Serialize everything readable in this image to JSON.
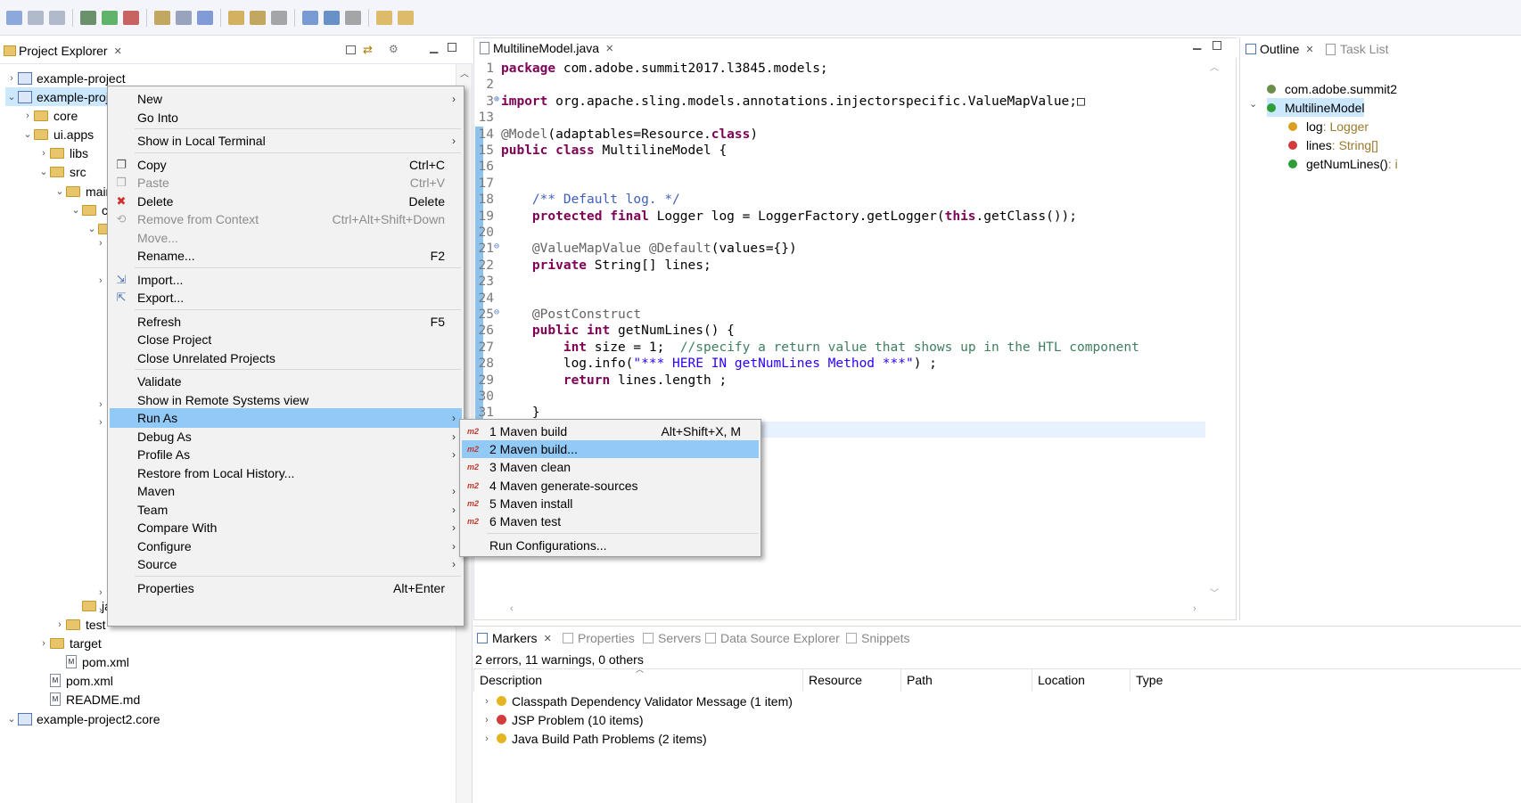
{
  "toolbar": {
    "icons": [
      "new-icon",
      "save-icon",
      "save-all-icon",
      "debug-icon",
      "run-icon",
      "run-external-icon",
      "new-package-icon",
      "new-class-icon",
      "open-type-icon",
      "open-folder-icon",
      "search-icon",
      "toggle-mark-icon",
      "globe-icon",
      "terminal-icon",
      "step-icon",
      "nav-back-icon",
      "nav-forward-icon"
    ]
  },
  "project_explorer": {
    "title": "Project Explorer",
    "tree": [
      {
        "label": "example-project",
        "depth": 0,
        "kind": "project",
        "chev": "›"
      },
      {
        "label": "example-proj",
        "depth": 0,
        "kind": "project",
        "chev": "⌄",
        "selected": true
      },
      {
        "label": "core",
        "depth": 1,
        "kind": "folder",
        "chev": "›"
      },
      {
        "label": "ui.apps",
        "depth": 1,
        "kind": "folder",
        "chev": "⌄"
      },
      {
        "label": "libs",
        "depth": 2,
        "kind": "folder",
        "chev": "›"
      },
      {
        "label": "src",
        "depth": 2,
        "kind": "folder",
        "chev": "⌄"
      },
      {
        "label": "mair",
        "depth": 3,
        "kind": "folder",
        "chev": "⌄"
      },
      {
        "label": "co",
        "depth": 4,
        "kind": "folder",
        "chev": "⌄"
      },
      {
        "label": "",
        "depth": 5,
        "kind": "folder",
        "chev": "⌄"
      },
      {
        "label": "ja",
        "depth": 4,
        "kind": "folder",
        "chev": ""
      },
      {
        "label": "test",
        "depth": 3,
        "kind": "folder",
        "chev": "›"
      },
      {
        "label": "target",
        "depth": 2,
        "kind": "folder",
        "chev": "›"
      },
      {
        "label": "pom.xml",
        "depth": 3,
        "kind": "file",
        "chev": ""
      },
      {
        "label": "pom.xml",
        "depth": 2,
        "kind": "file",
        "chev": ""
      },
      {
        "label": "README.md",
        "depth": 2,
        "kind": "file",
        "chev": ""
      },
      {
        "label": "example-project2.core",
        "depth": 0,
        "kind": "project",
        "chev": "⌄"
      }
    ]
  },
  "editor": {
    "tab": "MultilineModel.java",
    "lines": [
      {
        "n": "1",
        "html": "<span class='kw'>package</span> com.adobe.summit2017.l3845.models;"
      },
      {
        "n": "2",
        "html": ""
      },
      {
        "n": "3",
        "html": "<span class='kw'>import</span> org.apache.sling.models.annotations.injectorspecific.ValueMapValue;&#x25A1;"
      },
      {
        "n": "13",
        "html": ""
      },
      {
        "n": "14",
        "html": "<span class='ann'>@Model</span>(adaptables=Resource.<span class='kw'>class</span>)"
      },
      {
        "n": "15",
        "html": "<span class='kw'>public class</span> MultilineModel {"
      },
      {
        "n": "16",
        "html": ""
      },
      {
        "n": "17",
        "html": ""
      },
      {
        "n": "18",
        "html": "    <span class='cm'>/** Default log. */</span>"
      },
      {
        "n": "19",
        "html": "    <span class='kw'>protected final</span> Logger log = LoggerFactory.getLogger(<span class='kw'>this</span>.getClass());"
      },
      {
        "n": "20",
        "html": ""
      },
      {
        "n": "21",
        "html": "    <span class='ann'>@ValueMapValue @Default</span>(values={})"
      },
      {
        "n": "22",
        "html": "    <span class='kw'>private</span> String[] lines;"
      },
      {
        "n": "23",
        "html": ""
      },
      {
        "n": "24",
        "html": ""
      },
      {
        "n": "25",
        "html": "    <span class='ann'>@PostConstruct</span>"
      },
      {
        "n": "26",
        "html": "    <span class='kw'>public int</span> getNumLines() {"
      },
      {
        "n": "27",
        "html": "        <span class='kw'>int</span> size = 1;  <span class='cm2'>//specify a return value that shows up in the HTL component</span>"
      },
      {
        "n": "28",
        "html": "        log.info(<span class='str'>\"*** HERE IN getNumLines Method ***\"</span>) ;"
      },
      {
        "n": "29",
        "html": "        <span class='kw'>return</span> lines.length ;"
      },
      {
        "n": "30",
        "html": ""
      },
      {
        "n": "31",
        "html": "    }"
      }
    ]
  },
  "outline": {
    "tab": "Outline",
    "other_tab": "Task List",
    "items": [
      {
        "label": "com.adobe.summit2",
        "icon": "package-icon",
        "depth": 0,
        "type": ""
      },
      {
        "label": "MultilineModel",
        "icon": "class-icon",
        "depth": 0,
        "selected": true,
        "type": ""
      },
      {
        "label": "log",
        "icon": "field-icon",
        "depth": 1,
        "type": " : Logger"
      },
      {
        "label": "lines",
        "icon": "field-private-icon",
        "depth": 1,
        "type": " : String[]"
      },
      {
        "label": "getNumLines()",
        "icon": "method-icon",
        "depth": 1,
        "type": " : i"
      }
    ]
  },
  "markers": {
    "tabs": [
      "Markers",
      "Properties",
      "Servers",
      "Data Source Explorer",
      "Snippets"
    ],
    "summary": "2 errors, 11 warnings, 0 others",
    "columns": [
      "Description",
      "Resource",
      "Path",
      "Location",
      "Type"
    ],
    "rows": [
      {
        "label": "Classpath Dependency Validator Message (1 item)",
        "icon": "warning"
      },
      {
        "label": "JSP Problem (10 items)",
        "icon": "error"
      },
      {
        "label": "Java Build Path Problems (2 items)",
        "icon": "warning"
      }
    ]
  },
  "context_menu": {
    "items": [
      {
        "label": "New",
        "submenu": true
      },
      {
        "label": "Go Into"
      },
      {
        "sep": true
      },
      {
        "label": "Show in Local Terminal",
        "submenu": true
      },
      {
        "sep": true
      },
      {
        "label": "Copy",
        "shortcut": "Ctrl+C",
        "icon": "copy-icon"
      },
      {
        "label": "Paste",
        "shortcut": "Ctrl+V",
        "disabled": true,
        "icon": "paste-icon"
      },
      {
        "label": "Delete",
        "shortcut": "Delete",
        "icon": "delete-icon"
      },
      {
        "label": "Remove from Context",
        "shortcut": "Ctrl+Alt+Shift+Down",
        "disabled": true,
        "icon": "remove-context-icon"
      },
      {
        "label": "Move...",
        "disabled": true
      },
      {
        "label": "Rename...",
        "shortcut": "F2"
      },
      {
        "sep": true
      },
      {
        "label": "Import...",
        "icon": "import-icon"
      },
      {
        "label": "Export...",
        "icon": "export-icon"
      },
      {
        "sep": true
      },
      {
        "label": "Refresh",
        "shortcut": "F5"
      },
      {
        "label": "Close Project"
      },
      {
        "label": "Close Unrelated Projects"
      },
      {
        "sep": true
      },
      {
        "label": "Validate"
      },
      {
        "label": "Show in Remote Systems view"
      },
      {
        "label": "Run As",
        "submenu": true,
        "selected": true
      },
      {
        "label": "Debug As",
        "submenu": true
      },
      {
        "label": "Profile As",
        "submenu": true
      },
      {
        "label": "Restore from Local History..."
      },
      {
        "label": "Maven",
        "submenu": true
      },
      {
        "label": "Team",
        "submenu": true
      },
      {
        "label": "Compare With",
        "submenu": true
      },
      {
        "label": "Configure",
        "submenu": true
      },
      {
        "label": "Source",
        "submenu": true
      },
      {
        "sep": true
      },
      {
        "label": "Properties",
        "shortcut": "Alt+Enter"
      }
    ]
  },
  "run_as_menu": {
    "items": [
      {
        "label": "1 Maven build",
        "shortcut": "Alt+Shift+X, M",
        "badge": "m2"
      },
      {
        "label": "2 Maven build...",
        "badge": "m2",
        "selected": true
      },
      {
        "label": "3 Maven clean",
        "badge": "m2"
      },
      {
        "label": "4 Maven generate-sources",
        "badge": "m2"
      },
      {
        "label": "5 Maven install",
        "badge": "m2"
      },
      {
        "label": "6 Maven test",
        "badge": "m2"
      },
      {
        "sep": true
      },
      {
        "label": "Run Configurations..."
      }
    ]
  },
  "colors": {
    "selection": "#91c9f7",
    "menu_bg": "#f2f2f2",
    "keyword": "#7f0055",
    "comment": "#3f5fbf",
    "string": "#2a00ff"
  }
}
